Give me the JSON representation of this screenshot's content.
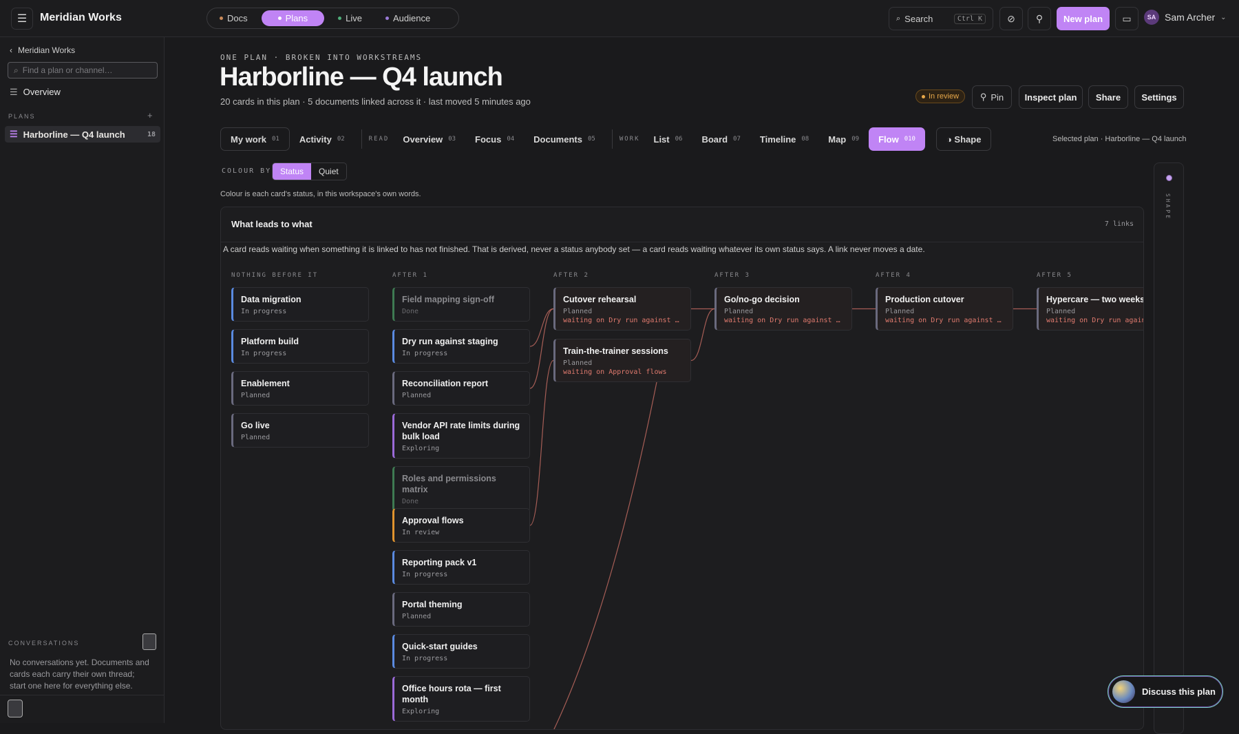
{
  "topbar": {
    "brand": "Meridian Works",
    "tabs": [
      {
        "label": "Docs",
        "dot": "#c98a5a"
      },
      {
        "label": "Plans",
        "dot": "#ffffff"
      },
      {
        "label": "Live",
        "dot": "#4fae7a"
      },
      {
        "label": "Audience",
        "dot": "#9a7ad8"
      }
    ],
    "search_label": "Search",
    "search_shortcut": "Ctrl K",
    "new_plan": "New plan",
    "user_initials": "SA",
    "user_name": "Sam Archer"
  },
  "sidebar": {
    "back_label": "Meridian Works",
    "search_placeholder": "Find a plan or channel…",
    "overview": "Overview",
    "plans_heading": "PLANS",
    "plans": [
      {
        "name": "Harborline — Q4 launch",
        "count": "18"
      }
    ],
    "conversations_heading": "CONVERSATIONS",
    "conversations_empty": "No conversations yet. Documents and cards each carry their own thread; start one here for everything else."
  },
  "header": {
    "eyebrow": "ONE PLAN · BROKEN INTO WORKSTREAMS",
    "title": "Harborline — Q4 launch",
    "subtitle": "20 cards in this plan · 5 documents linked across it · last moved 5 minutes ago",
    "status": "In review",
    "pin": "Pin",
    "inspect": "Inspect plan",
    "share": "Share",
    "settings": "Settings"
  },
  "views": {
    "personal": [
      {
        "label": "My work",
        "n": "01"
      },
      {
        "label": "Activity",
        "n": "02"
      }
    ],
    "read_group": "READ",
    "read": [
      {
        "label": "Overview",
        "n": "03"
      },
      {
        "label": "Focus",
        "n": "04"
      },
      {
        "label": "Documents",
        "n": "05"
      }
    ],
    "work_group": "WORK",
    "work": [
      {
        "label": "List",
        "n": "06"
      },
      {
        "label": "Board",
        "n": "07"
      },
      {
        "label": "Timeline",
        "n": "08"
      },
      {
        "label": "Map",
        "n": "09"
      },
      {
        "label": "Flow",
        "n": "010"
      }
    ],
    "shape": "◑ Shape",
    "selected": "Selected plan · Harborline — Q4 launch"
  },
  "colour": {
    "label": "COLOUR BY",
    "options": [
      "Status",
      "Quiet"
    ],
    "note": "Colour is each card's status, in this workspace's own words."
  },
  "status_colors": {
    "In progress": "#5a8ae0",
    "Planned": "#6a6a7e",
    "Done": "#3e7a52",
    "Exploring": "#9a6ad8",
    "In review": "#e0932e"
  },
  "flow": {
    "title": "What leads to what",
    "links_count": "7 links",
    "description": "A card reads waiting when something it is linked to has not finished. That is derived, never a status anybody set — a card reads waiting whatever its own status says. A link never moves a date.",
    "columns": [
      {
        "heading": "NOTHING BEFORE IT",
        "cards": [
          {
            "title": "Data migration",
            "status": "In progress"
          },
          {
            "title": "Platform build",
            "status": "In progress"
          },
          {
            "title": "Enablement",
            "status": "Planned"
          },
          {
            "title": "Go live",
            "status": "Planned"
          }
        ]
      },
      {
        "heading": "AFTER 1",
        "cards": [
          {
            "title": "Field mapping sign-off",
            "status": "Done"
          },
          {
            "title": "Dry run against staging",
            "status": "In progress"
          },
          {
            "title": "Reconciliation report",
            "status": "Planned"
          },
          {
            "title": "Vendor API rate limits during bulk load",
            "status": "Exploring"
          },
          {
            "title": "Roles and permissions matrix",
            "status": "Done"
          },
          {
            "title": "Approval flows",
            "status": "In review"
          },
          {
            "title": "Reporting pack v1",
            "status": "In progress"
          },
          {
            "title": "Portal theming",
            "status": "Planned"
          },
          {
            "title": "Quick-start guides",
            "status": "In progress"
          },
          {
            "title": "Office hours rota — first month",
            "status": "Exploring"
          }
        ]
      },
      {
        "heading": "AFTER 2",
        "cards": [
          {
            "title": "Cutover rehearsal",
            "status": "Planned",
            "waiting": "waiting on Dry run against staging"
          },
          {
            "title": "Train-the-trainer sessions",
            "status": "Planned",
            "waiting": "waiting on Approval flows"
          }
        ]
      },
      {
        "heading": "AFTER 3",
        "cards": [
          {
            "title": "Go/no-go decision",
            "status": "Planned",
            "waiting": "waiting on Dry run against staging"
          }
        ]
      },
      {
        "heading": "AFTER 4",
        "cards": [
          {
            "title": "Production cutover",
            "status": "Planned",
            "waiting": "waiting on Dry run against staging"
          }
        ]
      },
      {
        "heading": "AFTER 5",
        "cards": [
          {
            "title": "Hypercare — two weeks",
            "status": "Planned",
            "waiting": "waiting on Dry run against staging"
          }
        ]
      }
    ]
  },
  "shape_rail_label": "SHAPE",
  "discuss": "Discuss this plan"
}
